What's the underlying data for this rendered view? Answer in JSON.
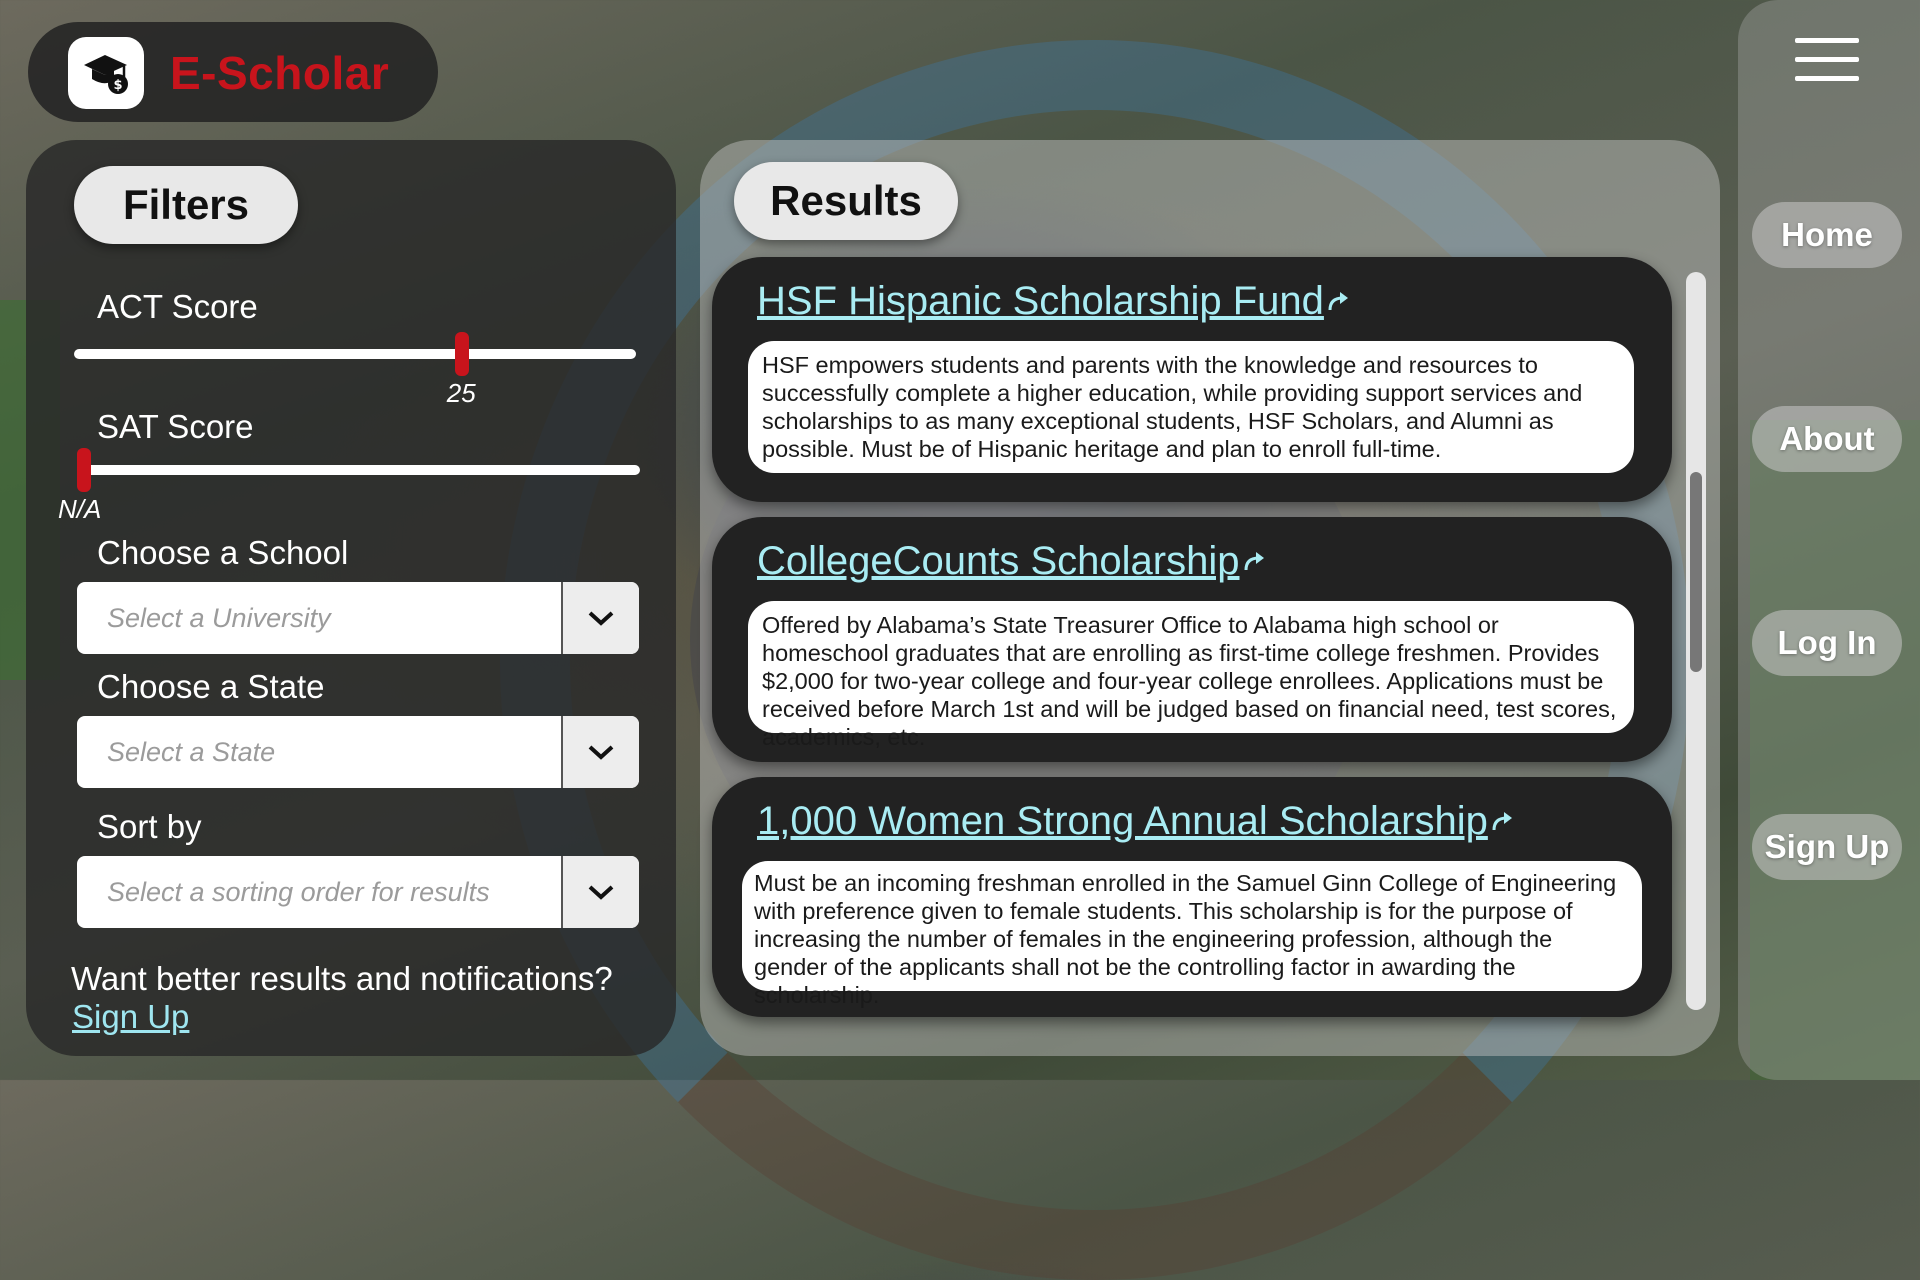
{
  "app": {
    "title": "E-Scholar",
    "logo_icon": "graduation-cap-dollar-icon"
  },
  "nav": {
    "menu_icon": "hamburger-menu-icon",
    "items": [
      {
        "label": "Home"
      },
      {
        "label": "About"
      },
      {
        "label": "Log In"
      },
      {
        "label": "Sign Up"
      }
    ]
  },
  "filters": {
    "title": "Filters",
    "act": {
      "label": "ACT Score",
      "value": "25",
      "position": 0.69
    },
    "sat": {
      "label": "SAT Score",
      "value": "N/A",
      "position": 0.0
    },
    "school": {
      "label": "Choose a School",
      "placeholder": "Select a University"
    },
    "state": {
      "label": "Choose a State",
      "placeholder": "Select a State"
    },
    "sort": {
      "label": "Sort by",
      "placeholder": "Select a sorting order for results"
    },
    "promo_text": "Want better results and notifications?",
    "promo_link": "Sign Up"
  },
  "results": {
    "title": "Results",
    "items": [
      {
        "title": "HSF Hispanic Scholarship Fund",
        "description": "HSF empowers students and parents with the knowledge and resources to successfully complete a higher education, while providing support services and scholarships to as many exceptional students, HSF Scholars, and Alumni as possible. Must be of Hispanic heritage and plan to enroll full-time."
      },
      {
        "title": "CollegeCounts Scholarship",
        "description": "Offered by Alabama’s State Treasurer Office to Alabama high school or homeschool graduates that are enrolling as first-time college freshmen. Provides $2,000 for two-year college and four-year college enrollees. Applications must be received before March 1st and will be judged based on financial need, test scores, academics, etc."
      },
      {
        "title": "1,000 Women Strong Annual Scholarship",
        "description": "Must be an incoming freshman enrolled in the Samuel Ginn College of Engineering with preference given to female students. This scholarship is for the purpose of increasing the number of females in the engineering profession, although the gender of the applicants shall not be the controlling factor in awarding the scholarship."
      }
    ]
  },
  "colors": {
    "brand_red": "#c8141c",
    "link_cyan": "#a9ecf3"
  }
}
